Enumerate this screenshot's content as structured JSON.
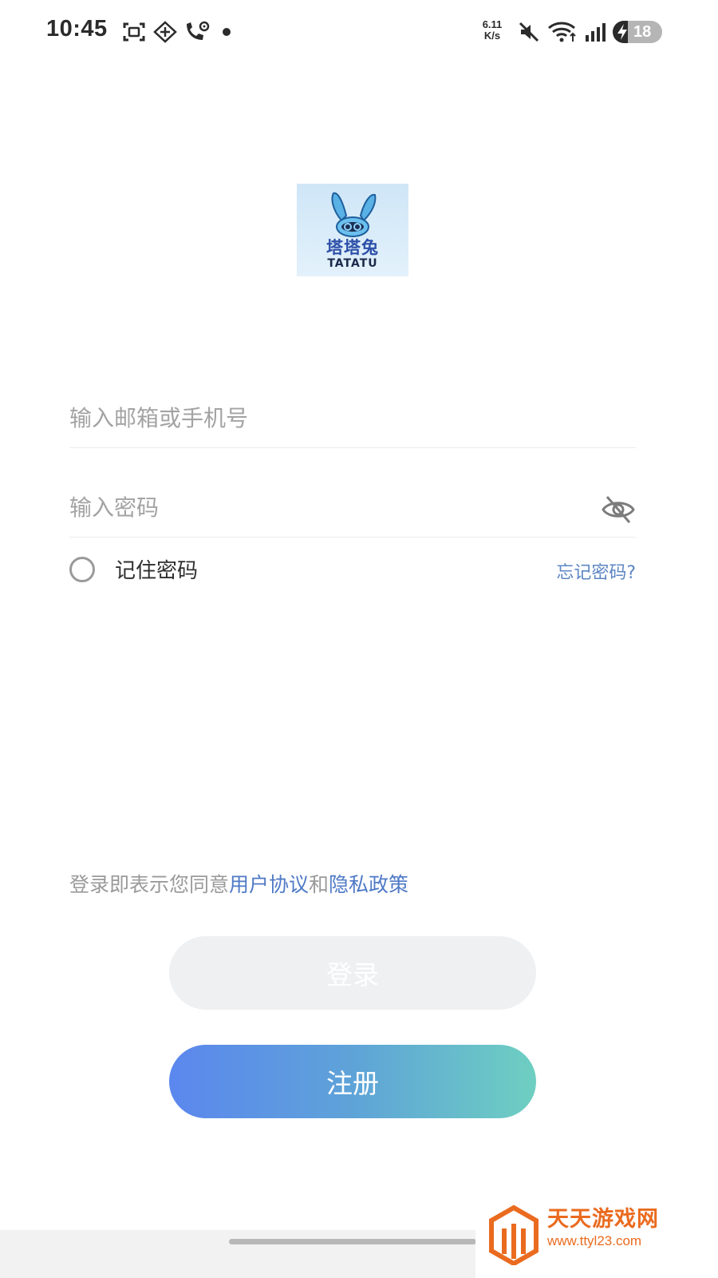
{
  "status_bar": {
    "time": "10:45",
    "net_speed_value": "6.11",
    "net_speed_unit": "K/s",
    "battery_level": "18",
    "icons": [
      "screenshot-icon",
      "gamepad-icon",
      "call-location-icon",
      "dot-icon",
      "mute-icon",
      "wifi-icon",
      "signal-icon",
      "charging-bolt-icon"
    ]
  },
  "logo": {
    "cn_text": "塔塔兔",
    "en_text": "TATATU"
  },
  "login_form": {
    "account_placeholder": "输入邮箱或手机号",
    "account_value": "",
    "password_placeholder": "输入密码",
    "password_value": "",
    "remember_label": "记住密码",
    "remember_checked": false,
    "forgot_label": "忘记密码?"
  },
  "agreement": {
    "prefix": "登录即表示您同意",
    "user_agreement": "用户协议",
    "conjunction": "和",
    "privacy_policy": "隐私政策"
  },
  "buttons": {
    "login_label": "登录",
    "register_label": "注册"
  },
  "watermark": {
    "title": "天天游戏网",
    "url": "www.ttyl23.com"
  },
  "colors": {
    "accent_link": "#4f7ac6",
    "register_gradient_start": "#5b87ee",
    "register_gradient_end": "#6ecfc1",
    "login_disabled_bg": "#eff0f2",
    "watermark_orange": "#ea6b1f"
  }
}
